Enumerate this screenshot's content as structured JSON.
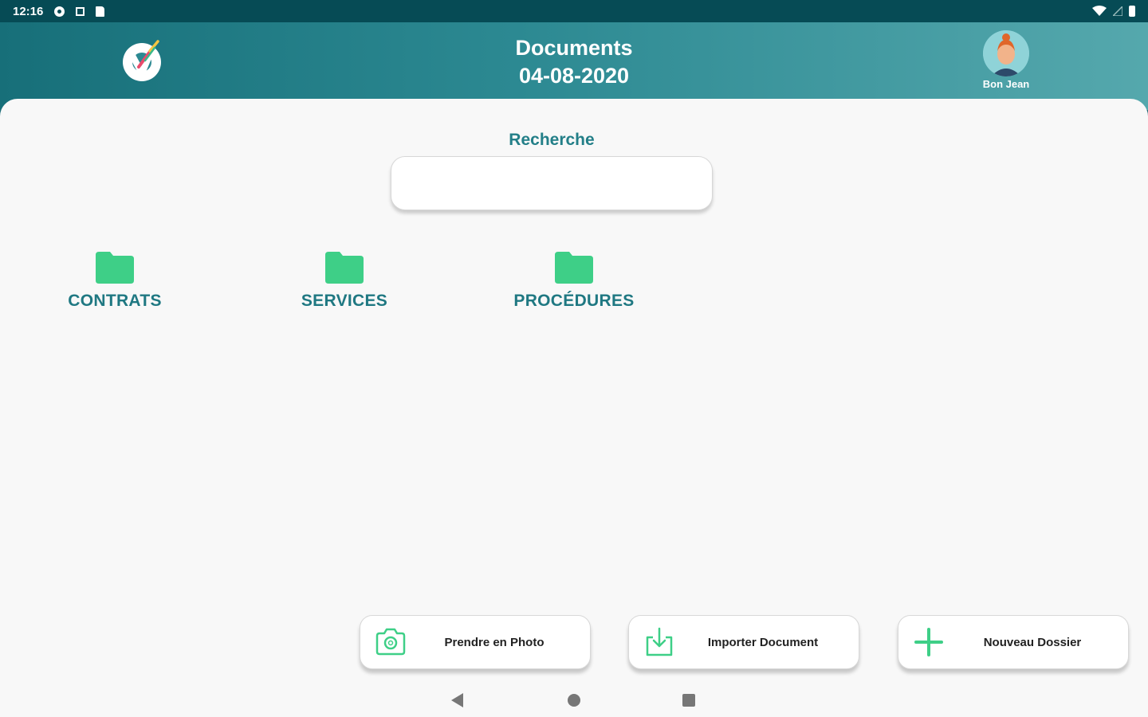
{
  "status_bar": {
    "time": "12:16",
    "icons": [
      "settings-icon",
      "square-notification-icon",
      "sd-card-icon",
      "wifi-icon",
      "signal-icon",
      "battery-icon"
    ]
  },
  "header": {
    "title": "Documents",
    "date": "04-08-2020",
    "user_name": "Bon Jean",
    "colors": {
      "gradient_start": "#176f79",
      "gradient_end": "#55a8ad"
    }
  },
  "search": {
    "label": "Recherche",
    "value": "",
    "placeholder": ""
  },
  "folders": [
    {
      "label": "CONTRATS",
      "icon": "folder-icon"
    },
    {
      "label": "SERVICES",
      "icon": "folder-icon"
    },
    {
      "label": "PROCÉDURES",
      "icon": "folder-icon"
    }
  ],
  "actions": {
    "photo": {
      "label": "Prendre en Photo",
      "icon": "camera-icon"
    },
    "import": {
      "label": "Importer Document",
      "icon": "download-icon"
    },
    "new_folder": {
      "label": "Nouveau Dossier",
      "icon": "plus-icon"
    }
  },
  "nav": {
    "icons": [
      "back-icon",
      "home-icon",
      "recents-icon"
    ]
  },
  "colors": {
    "accent": "#237f88",
    "folder": "#3ecf87",
    "background": "#f8f8f8"
  }
}
